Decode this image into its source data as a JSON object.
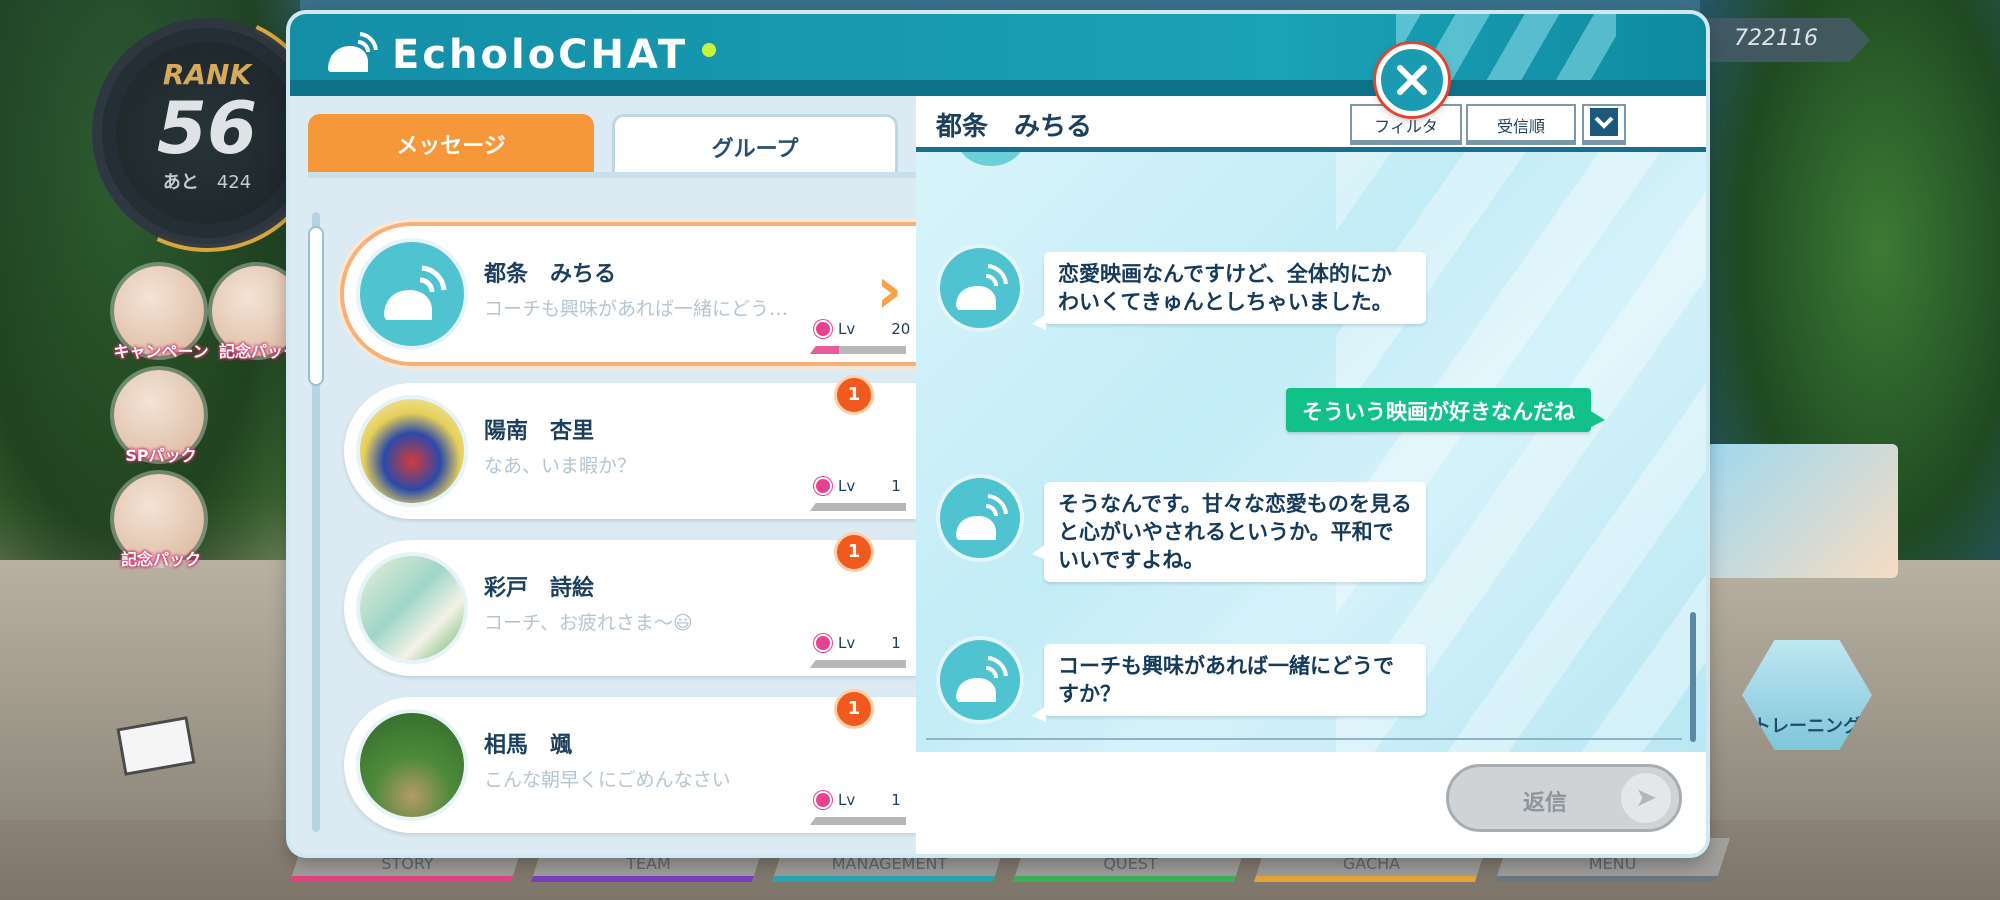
{
  "hud": {
    "rank_label": "RANK",
    "rank_value": "56",
    "rank_next_label": "あと",
    "rank_next_value": "424",
    "currency": "722116",
    "side_buttons": [
      "キャンペーン",
      "記念パック",
      "SPパック",
      "記念パック"
    ],
    "training_label": "トレーニング",
    "nav": [
      "STORY",
      "TEAM",
      "MANAGEMENT",
      "QUEST",
      "GACHA",
      "MENU"
    ]
  },
  "chat": {
    "app_title": "EcholoCHAT",
    "tabs": {
      "messages": "メッセージ",
      "groups": "グループ"
    },
    "contacts": [
      {
        "name": "都条　みちる",
        "preview": "コーチも興味があれば一緒にどう…",
        "lv_label": "Lv",
        "lv": "20",
        "badge": "",
        "selected": true
      },
      {
        "name": "陽南　杏里",
        "preview": "なあ、いま暇か？",
        "lv_label": "Lv",
        "lv": "1",
        "badge": "1",
        "selected": false
      },
      {
        "name": "彩戸　詩絵",
        "preview": "コーチ、お疲れさま〜😃",
        "lv_label": "Lv",
        "lv": "1",
        "badge": "1",
        "selected": false
      },
      {
        "name": "相馬　颯",
        "preview": "こんな朝早くにごめんなさい",
        "lv_label": "Lv",
        "lv": "1",
        "badge": "1",
        "selected": false
      }
    ],
    "conversation": {
      "title": "都条　みちる",
      "filter_label": "フィルタ",
      "sort_label": "受信順",
      "messages": [
        {
          "from": "other",
          "text": "恋愛映画なんですけど、全体的にかわいくてきゅんとしちゃいました。"
        },
        {
          "from": "me",
          "text": "そういう映画が好きなんだね"
        },
        {
          "from": "other",
          "text": "そうなんです。甘々な恋愛ものを見ると心がいやされるというか。平和でいいですよね。"
        },
        {
          "from": "other",
          "text": "コーチも興味があれば一緒にどうですか？"
        }
      ],
      "reply_label": "返信"
    }
  },
  "colors": {
    "header": "#1aa2b8",
    "active_tab": "#f6973a",
    "my_bubble": "#12c08a",
    "badge": "#f05a1e",
    "heart": "#e8418f"
  }
}
